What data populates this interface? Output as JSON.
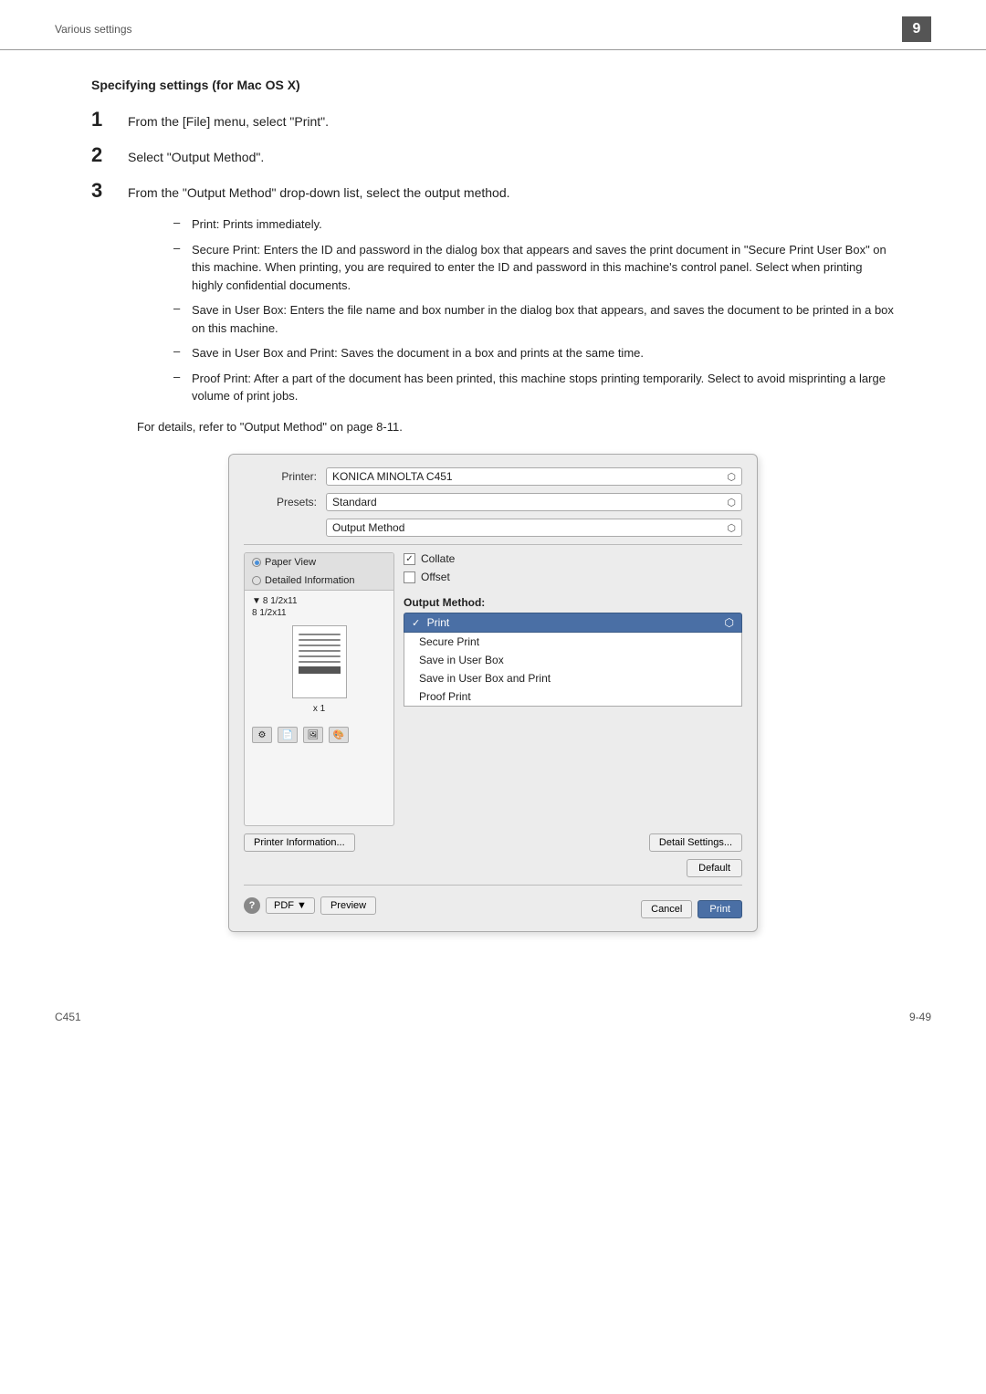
{
  "header": {
    "breadcrumb": "Various settings",
    "chapter_number": "9"
  },
  "section": {
    "title": "Specifying settings (for Mac OS X)"
  },
  "steps": [
    {
      "number": "1",
      "text": "From the [File] menu, select \"Print\"."
    },
    {
      "number": "2",
      "text": "Select \"Output Method\"."
    },
    {
      "number": "3",
      "text": "From the \"Output Method\" drop-down list, select the output method."
    }
  ],
  "bullets": [
    {
      "text": "Print: Prints immediately."
    },
    {
      "text": "Secure Print: Enters the ID and password in the dialog box that appears and saves the print document in \"Secure Print User Box\" on this machine. When printing, you are required to enter the ID and password in this machine's control panel. Select when printing highly confidential documents."
    },
    {
      "text": "Save in User Box: Enters the file name and box number in the dialog box that appears, and saves the document to be printed in a box on this machine."
    },
    {
      "text": "Save in User Box and Print: Saves the document in a box and prints at the same time."
    },
    {
      "text": "Proof Print: After a part of the document has been printed, this machine stops printing temporarily. Select to avoid misprinting a large volume of print jobs."
    }
  ],
  "refer_text": "For details, refer to \"Output Method\" on page 8-11.",
  "dialog": {
    "printer_label": "Printer:",
    "printer_value": "KONICA MINOLTA C451",
    "presets_label": "Presets:",
    "presets_value": "Standard",
    "panel_label": "Output Method",
    "tabs": [
      {
        "label": "Paper View",
        "active": true,
        "radio": "filled"
      },
      {
        "label": "Detailed Information",
        "active": false,
        "radio": "empty"
      }
    ],
    "paper_sizes": [
      "8 1/2x11",
      "8 1/2x11"
    ],
    "paper_count": "x 1",
    "collate_label": "Collate",
    "offset_label": "Offset",
    "output_method_label": "Output Method:",
    "dropdown_selected": "Print",
    "dropdown_items": [
      "Print",
      "Secure Print",
      "Save in User Box",
      "Save in User Box and Print",
      "Proof Print"
    ],
    "printer_info_btn": "Printer Information...",
    "detail_settings_btn": "Detail Settings...",
    "default_btn": "Default",
    "cancel_btn": "Cancel",
    "print_btn": "Print",
    "pdf_btn": "PDF ▼",
    "preview_btn": "Preview"
  },
  "footer": {
    "model": "C451",
    "page": "9-49"
  }
}
